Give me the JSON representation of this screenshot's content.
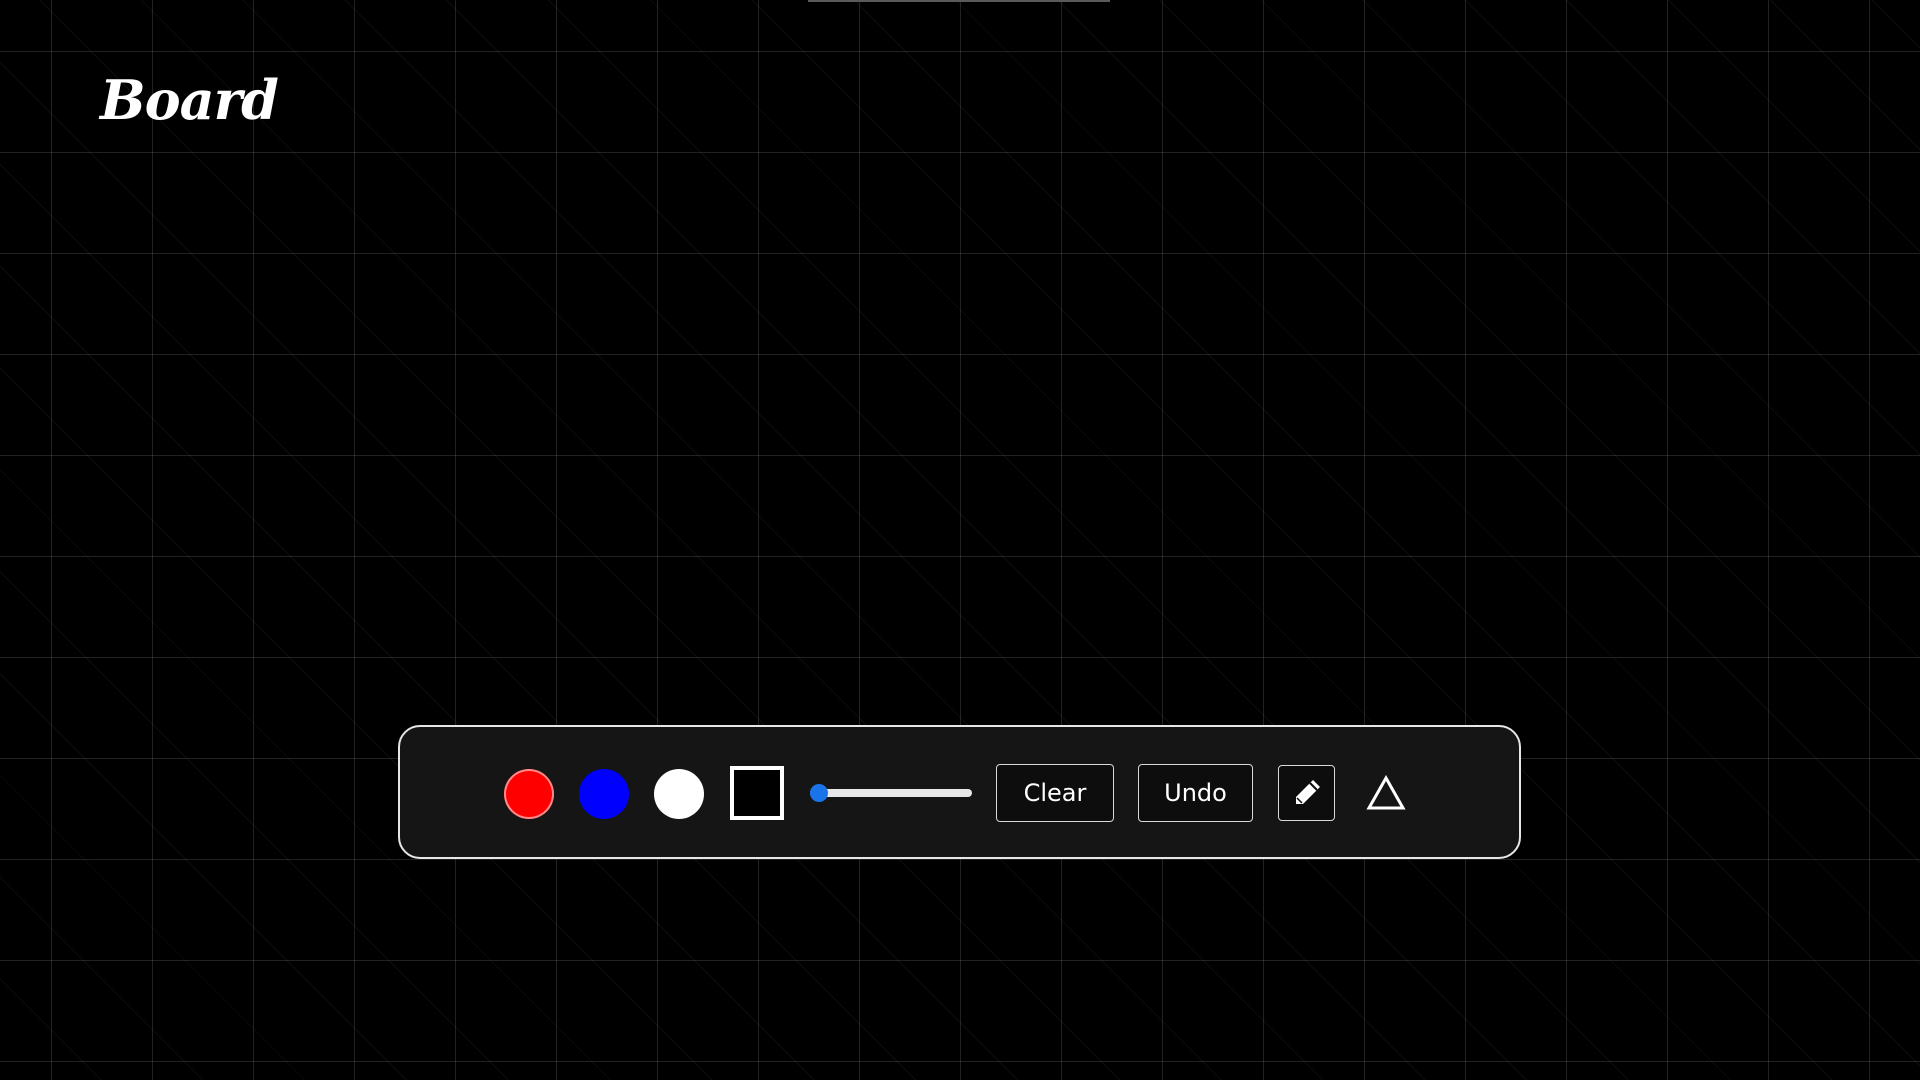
{
  "app": {
    "logo_text": "Board"
  },
  "toolbar": {
    "colors": [
      {
        "name": "red",
        "hex": "#ff0000"
      },
      {
        "name": "blue",
        "hex": "#0000ff"
      },
      {
        "name": "white",
        "hex": "#ffffff"
      },
      {
        "name": "black",
        "hex": "#000000"
      }
    ],
    "brush_size": {
      "value_fraction": 0.0
    },
    "clear_label": "Clear",
    "undo_label": "Undo",
    "tools": [
      {
        "icon": "pencil-icon",
        "selected": true
      },
      {
        "icon": "triangle-icon",
        "selected": false
      }
    ]
  }
}
